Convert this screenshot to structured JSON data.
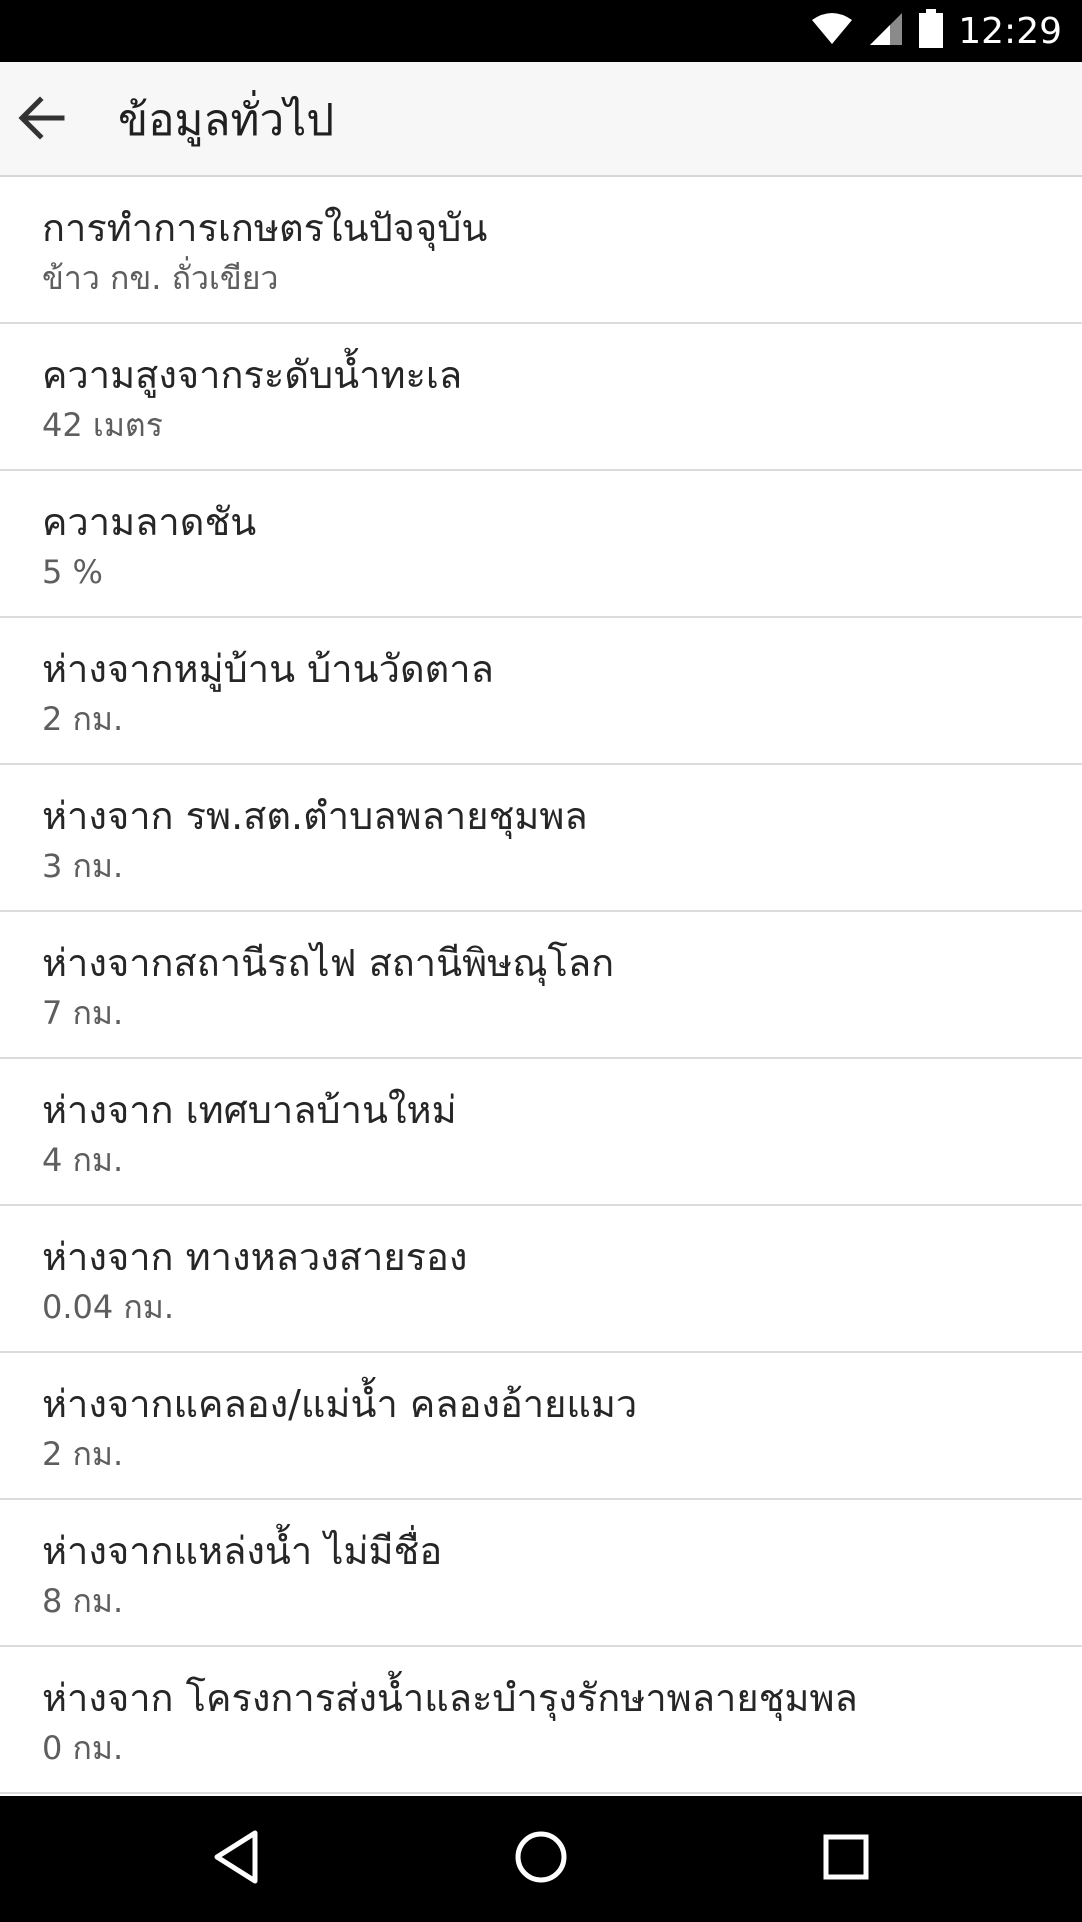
{
  "status_bar": {
    "time": "12:29",
    "icons": [
      "wifi-icon",
      "cell-signal-icon",
      "battery-icon"
    ]
  },
  "app_bar": {
    "back_icon": "arrow-left-icon",
    "title": "ข้อมูลทั่วไป"
  },
  "items": [
    {
      "title": "การทำการเกษตรในปัจจุบัน",
      "value": "ข้าว กข. ถั่วเขียว"
    },
    {
      "title": "ความสูงจากระดับน้ำทะเล",
      "value": "42 เมตร"
    },
    {
      "title": "ความลาดชัน",
      "value": "5 %"
    },
    {
      "title": "ห่างจากหมู่บ้าน บ้านวัดตาล",
      "value": "2 กม."
    },
    {
      "title": "ห่างจาก รพ.สต.ตำบลพลายชุมพล",
      "value": "3 กม."
    },
    {
      "title": "ห่างจากสถานีรถไฟ สถานีพิษณุโลก",
      "value": "7 กม."
    },
    {
      "title": "ห่างจาก เทศบาลบ้านใหม่",
      "value": "4 กม."
    },
    {
      "title": "ห่างจาก ทางหลวงสายรอง",
      "value": "0.04 กม."
    },
    {
      "title": "ห่างจากแคลอง/แม่น้ำ คลองอ้ายแมว",
      "value": "2 กม."
    },
    {
      "title": "ห่างจากแหล่งน้ำ ไม่มีชื่อ",
      "value": "8 กม."
    },
    {
      "title": "ห่างจาก โครงการส่งน้ำและบำรุงรักษาพลายชุมพล",
      "value": "0 กม."
    }
  ],
  "nav_bar": {
    "buttons": [
      "back-triangle-icon",
      "home-circle-icon",
      "recents-square-icon"
    ]
  },
  "colors": {
    "status_bar": "#000000",
    "app_bar": "#f7f7f7",
    "title_text": "#262626",
    "value_text": "#5e5e5e",
    "divider": "#dcdcdc"
  }
}
